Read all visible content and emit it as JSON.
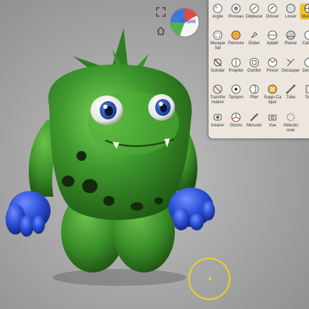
{
  "navigation": {
    "cube_label": "Front",
    "icons": [
      "frame-icon",
      "home-icon"
    ]
  },
  "tools": {
    "rows": [
      [
        {
          "id": "argile",
          "label": "Argile",
          "icon": "clay-icon"
        },
        {
          "id": "pinceau",
          "label": "Pinceau",
          "icon": "brush-icon"
        },
        {
          "id": "deplacer",
          "label": "Déplacer",
          "icon": "move-icon"
        },
        {
          "id": "glisser",
          "label": "Glisser",
          "icon": "drag-icon"
        },
        {
          "id": "lisser",
          "label": "Lisser",
          "icon": "smooth-icon"
        },
        {
          "id": "masque",
          "label": "Masque",
          "icon": "mask-icon",
          "active": true
        }
      ],
      [
        {
          "id": "masque-sel",
          "label": "Masque Sél",
          "icon": "mask-select-icon"
        },
        {
          "id": "peinture",
          "label": "Peinture",
          "icon": "paint-icon"
        },
        {
          "id": "etaler",
          "label": "Etaler",
          "icon": "spread-icon"
        },
        {
          "id": "aplatir",
          "label": "Aplatir",
          "icon": "flatten-icon"
        },
        {
          "id": "planar",
          "label": "Planar",
          "icon": "planar-icon"
        },
        {
          "id": "calque",
          "label": "Calque",
          "icon": "layer-icon"
        }
      ],
      [
        {
          "id": "scinder",
          "label": "Scinder",
          "icon": "split-icon"
        },
        {
          "id": "projeter",
          "label": "Projeter",
          "icon": "project-icon"
        },
        {
          "id": "gonfler",
          "label": "Gonfler",
          "icon": "inflate-icon"
        },
        {
          "id": "pincer",
          "label": "Pincer",
          "icon": "pinch-icon"
        },
        {
          "id": "decouper",
          "label": "Découper",
          "icon": "cut-icon"
        },
        {
          "id": "decaler",
          "label": "Décale",
          "icon": "offset-icon"
        }
      ],
      [
        {
          "id": "transformation",
          "label": "Transfor mation",
          "icon": "transform-icon"
        },
        {
          "id": "tampon",
          "label": "Tampon",
          "icon": "stamp-icon"
        },
        {
          "id": "plier",
          "label": "Plier",
          "icon": "fold-icon"
        },
        {
          "id": "supprimer",
          "label": "Suppr.Ca lque",
          "icon": "delete-layer-icon"
        },
        {
          "id": "tube",
          "label": "Tube",
          "icon": "tube-icon"
        },
        {
          "id": "tour",
          "label": "Tour",
          "icon": "lathe-icon"
        }
      ],
      [
        {
          "id": "inserer",
          "label": "Insérer",
          "icon": "insert-icon"
        },
        {
          "id": "gizmo",
          "label": "Gizmo",
          "icon": "gizmo-icon"
        },
        {
          "id": "mesurer",
          "label": "Mesurer",
          "icon": "measure-icon"
        },
        {
          "id": "vue",
          "label": "Vue",
          "icon": "camera-icon"
        },
        {
          "id": "selectionner",
          "label": "Sélectio nner",
          "icon": "select-icon"
        }
      ]
    ]
  },
  "colors": {
    "panel_bg": "#ece6df",
    "active_tool": "#f2c12e",
    "cursor": "#f2d21a",
    "monster_green": "#3f9a2e",
    "hand_blue": "#2a4fd6"
  }
}
